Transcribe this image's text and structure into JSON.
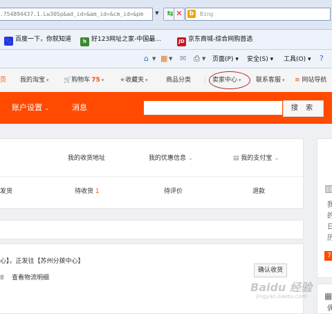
{
  "browser": {
    "address_text": ".754894437.1.Lw30Sp&ad_id=&am_id=&cm_id=&pm",
    "search_placeholder": "Bing",
    "favorites": [
      {
        "label": "百度一下，你就知道",
        "icon": "baidu-icon",
        "color": "#2932e1"
      },
      {
        "label": "好123网址之家-中国最...",
        "icon": "hao123-icon",
        "color": "#3a8a2f"
      },
      {
        "label": "京东商城-综合网购首选",
        "icon": "jd-icon",
        "color": "#c81623"
      }
    ],
    "commands": {
      "page": "页面(P)",
      "safety": "安全(S)",
      "tools": "工具(O)"
    }
  },
  "site": {
    "topnav": {
      "home_fragment": "页",
      "my_taobao": "我的淘宝",
      "cart": "购物车",
      "cart_count": "75",
      "favorites": "收藏夹",
      "categories": "商品分类",
      "seller_center": "卖家中心",
      "contact": "联系客服",
      "site_nav": "网站导航"
    },
    "header": {
      "account_settings": "账户设置",
      "messages": "消息",
      "search_button": "搜 索"
    },
    "links": {
      "address": "我的收货地址",
      "coupons": "我的优惠信息",
      "alipay": "我的支付宝"
    },
    "tabs": [
      {
        "label": "发货",
        "count": ""
      },
      {
        "label": "待收货",
        "count": "1"
      },
      {
        "label": "待评价",
        "count": ""
      },
      {
        "label": "退款",
        "count": ""
      }
    ],
    "order": {
      "status_text": "心】，正发往【苏州分拨中心】",
      "num_fragment": "8",
      "logistics_link": "查看物流明细",
      "confirm_button": "确认收货"
    },
    "sidebar_fragments": [
      "我",
      "的",
      "日",
      "历"
    ],
    "sidebar_badge": "7",
    "sidebar_bottom": "偶",
    "watermark": "Baidu 经验",
    "watermark_url": "jingyan.baidu.com"
  },
  "colors": {
    "brand_orange": "#ff4a00",
    "link_red": "#ff4a00",
    "circle_red": "#b0242a"
  }
}
